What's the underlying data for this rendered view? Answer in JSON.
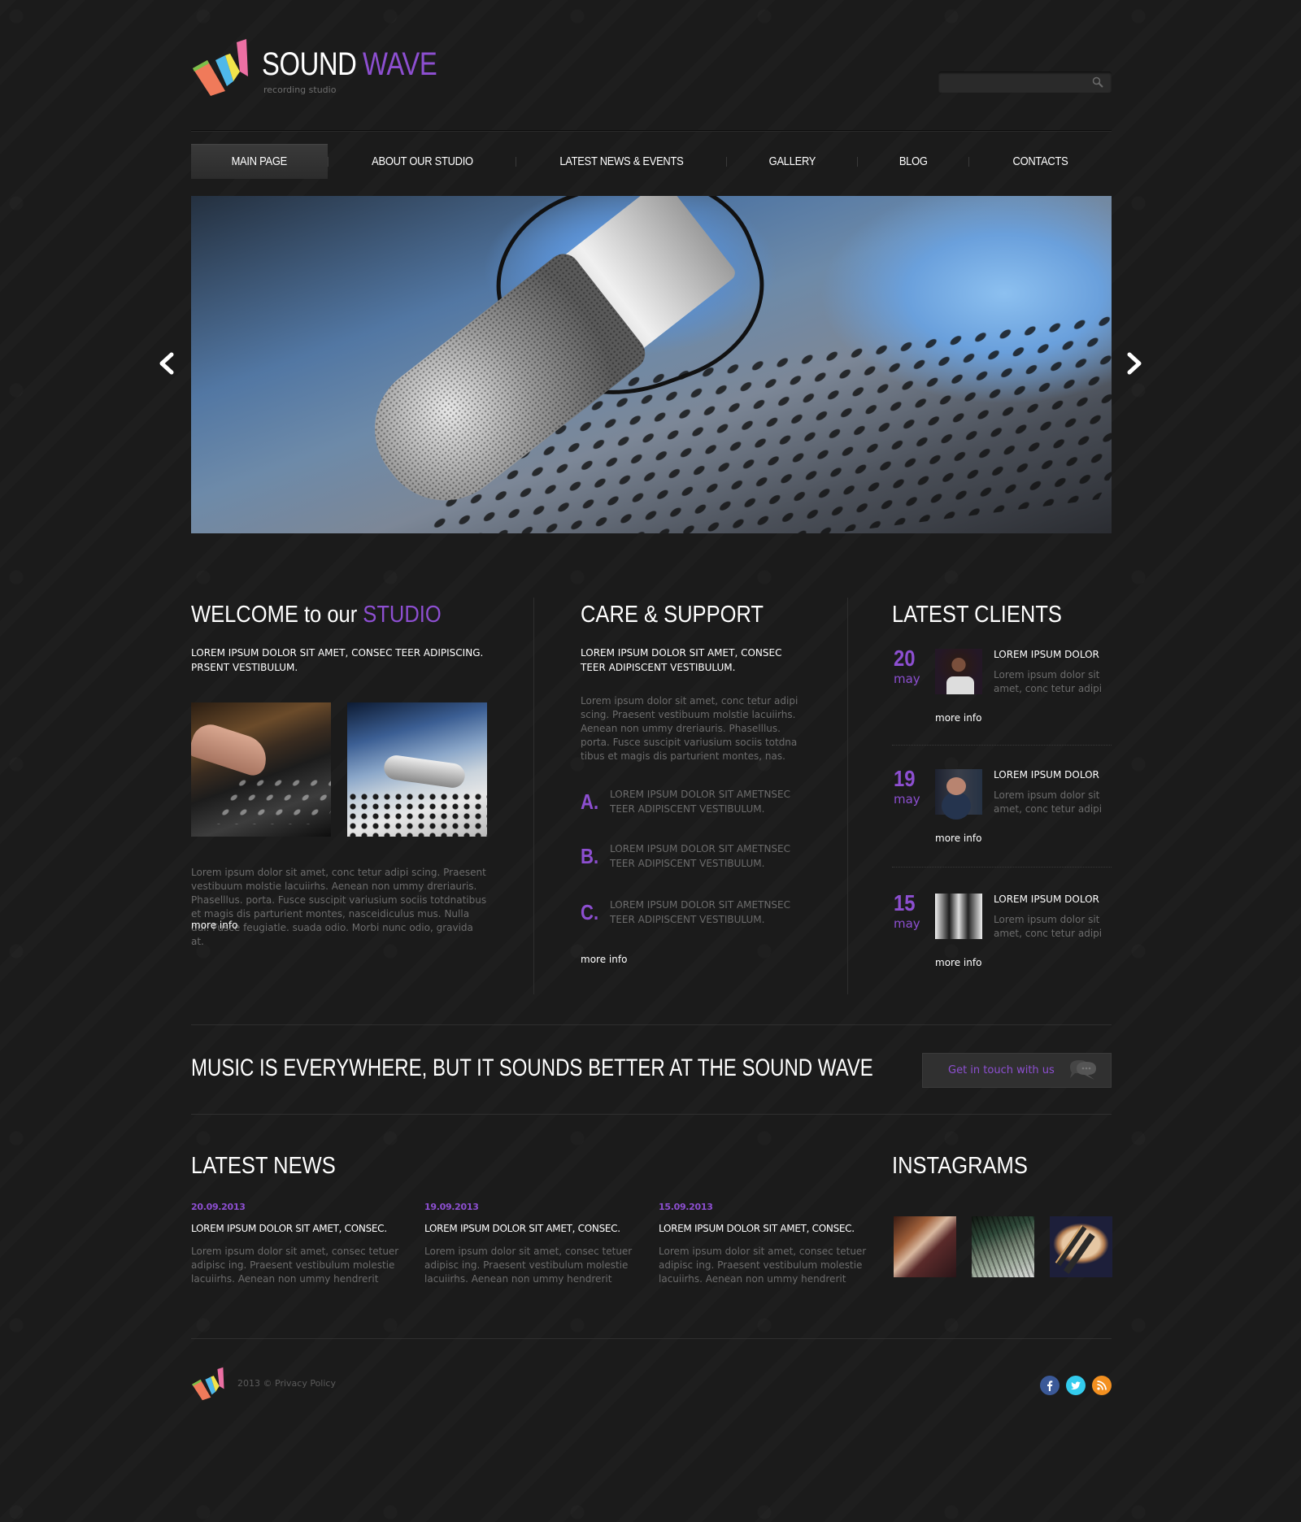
{
  "header": {
    "brand_word1": "SOUND",
    "brand_word2": "WAVE",
    "tagline": "recording studio",
    "search": {
      "placeholder": "",
      "value": "",
      "icon": "search-icon"
    }
  },
  "nav": {
    "items": [
      {
        "label": "MAIN PAGE",
        "active": true
      },
      {
        "label": "ABOUT OUR STUDIO"
      },
      {
        "label": "LATEST NEWS & EVENTS"
      },
      {
        "label": "GALLERY"
      },
      {
        "label": "BLOG"
      },
      {
        "label": "CONTACTS"
      }
    ]
  },
  "slider": {
    "prev_icon": "chevron-left-icon",
    "next_icon": "chevron-right-icon"
  },
  "welcome": {
    "title_white": "WELCOME to our",
    "title_purple": "STUDIO",
    "subtitle": "LOREM IPSUM DOLOR SIT AMET, CONSEC TEER ADIPISCING. PRSENT VESTIBULUM.",
    "body": "Lorem ipsum dolor sit amet, conc tetur adipi scing. Praesent vestibuum molstie lacuiirhs. Aenean non ummy dreriauris. Phaselllus. porta. Fusce suscipit variusium sociis totdnatibus et magis dis parturient montes, nasceidiculus mus. Nulla dui. Fusce feugiatle. suada odio. Morbi nunc odio, gravida at.",
    "more": "more info"
  },
  "care": {
    "title": "CARE & SUPPORT",
    "subtitle": "LOREM IPSUM DOLOR SIT AMET, CONSEC TEER ADIPISCENT VESTIBULUM.",
    "body": "Lorem ipsum dolor sit amet, conc tetur adipi scing. Praesent vestibuum molstie lacuiirhs. Aenean non ummy dreriauris. Phaselllus. porta. Fusce suscipit variusium sociis totdna tibus et magis dis parturient montes, nas.",
    "list": [
      {
        "letter": "A.",
        "text": "LOREM IPSUM DOLOR SIT AMETNSEC TEER ADIPISCENT VESTIBULUM."
      },
      {
        "letter": "B.",
        "text": "LOREM IPSUM DOLOR SIT AMETNSEC TEER ADIPISCENT VESTIBULUM."
      },
      {
        "letter": "C.",
        "text": "LOREM IPSUM DOLOR SIT AMETNSEC TEER ADIPISCENT VESTIBULUM."
      }
    ],
    "more": "more info"
  },
  "clients": {
    "title": "LATEST CLIENTS",
    "items": [
      {
        "day": "20",
        "month": "may",
        "title": "LOREM IPSUM DOLOR",
        "text": "Lorem ipsum dolor sit amet, conc tetur adipi",
        "more": "more info"
      },
      {
        "day": "19",
        "month": "may",
        "title": "LOREM IPSUM DOLOR",
        "text": "Lorem ipsum dolor sit amet, conc tetur adipi",
        "more": "more info"
      },
      {
        "day": "15",
        "month": "may",
        "title": "LOREM IPSUM DOLOR",
        "text": "Lorem ipsum dolor sit amet, conc tetur adipi",
        "more": "more info"
      }
    ]
  },
  "banner": {
    "text": "MUSIC IS EVERYWHERE, BUT IT SOUNDS BETTER AT THE SOUND WAVE",
    "cta_label": "Get in touch  with us",
    "cta_icon": "chat-bubbles-icon"
  },
  "news": {
    "title": "LATEST NEWS",
    "items": [
      {
        "date": "20.09.2013",
        "title": "LOREM IPSUM DOLOR SIT AMET, CONSEC.",
        "text": "Lorem ipsum dolor sit amet, consec tetuer adipisc ing. Praesent vestibulum molestie lacuiirhs. Aenean non ummy hendrerit"
      },
      {
        "date": "19.09.2013",
        "title": "LOREM IPSUM DOLOR SIT AMET, CONSEC.",
        "text": "Lorem ipsum dolor sit amet, consec tetuer adipisc ing. Praesent vestibulum molestie lacuiirhs. Aenean non ummy hendrerit"
      },
      {
        "date": "15.09.2013",
        "title": "LOREM IPSUM DOLOR SIT AMET, CONSEC.",
        "text": "Lorem ipsum dolor sit amet, consec tetuer adipisc ing. Praesent vestibulum molestie lacuiirhs. Aenean non ummy hendrerit"
      }
    ]
  },
  "instagrams": {
    "title": "INSTAGRAMS"
  },
  "footer": {
    "year": "2013 ©",
    "privacy": "Privacy Policy",
    "social": [
      {
        "name": "facebook",
        "color": "#3b5998"
      },
      {
        "name": "twitter",
        "color": "#33ccee"
      },
      {
        "name": "rss",
        "color": "#f39020"
      }
    ]
  },
  "colors": {
    "accent": "#8d4fd1",
    "background": "#1b1b1b",
    "muted_text": "#6c6c6c"
  }
}
